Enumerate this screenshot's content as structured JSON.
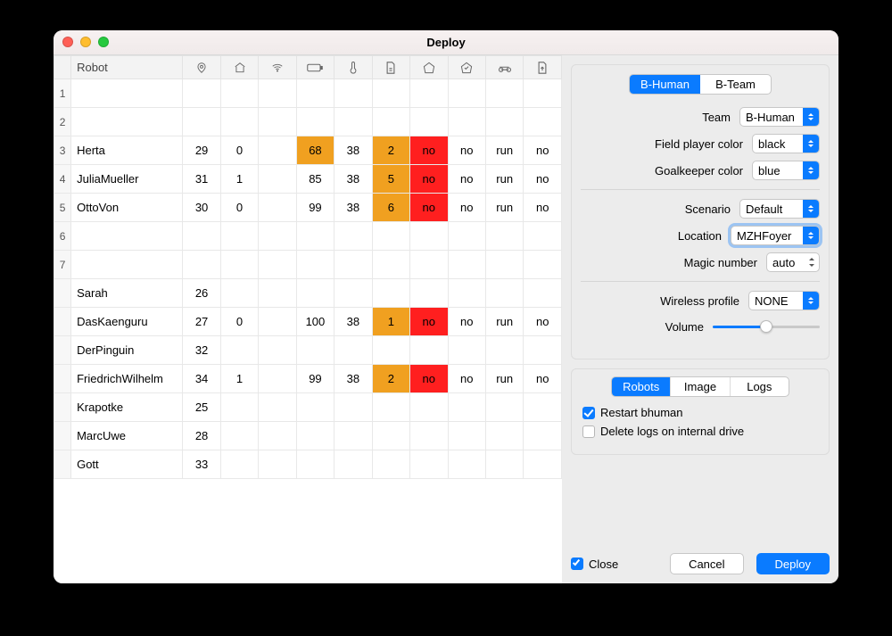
{
  "window": {
    "title": "Deploy"
  },
  "table": {
    "header": {
      "robot": "Robot"
    },
    "rows": [
      {
        "num": "1"
      },
      {
        "num": "2"
      },
      {
        "num": "3",
        "name": "Herta",
        "c1": "29",
        "c2": "0",
        "c4": "68",
        "c4c": "orange",
        "c5": "38",
        "c6": "2",
        "c6c": "orange",
        "c7": "no",
        "c7c": "red",
        "c8": "no",
        "c9": "run",
        "c10": "no"
      },
      {
        "num": "4",
        "name": "JuliaMueller",
        "c1": "31",
        "c2": "1",
        "c4": "85",
        "c5": "38",
        "c6": "5",
        "c6c": "orange",
        "c7": "no",
        "c7c": "red",
        "c8": "no",
        "c9": "run",
        "c10": "no"
      },
      {
        "num": "5",
        "name": "OttoVon",
        "c1": "30",
        "c2": "0",
        "c4": "99",
        "c5": "38",
        "c6": "6",
        "c6c": "orange",
        "c7": "no",
        "c7c": "red",
        "c8": "no",
        "c9": "run",
        "c10": "no"
      },
      {
        "num": "6"
      },
      {
        "num": "7"
      },
      {
        "name": "Sarah",
        "c1": "26"
      },
      {
        "name": "DasKaenguru",
        "c1": "27",
        "c2": "0",
        "c4": "100",
        "c5": "38",
        "c6": "1",
        "c6c": "orange",
        "c7": "no",
        "c7c": "red",
        "c8": "no",
        "c9": "run",
        "c10": "no"
      },
      {
        "name": "DerPinguin",
        "c1": "32"
      },
      {
        "name": "FriedrichWilhelm",
        "c1": "34",
        "c2": "1",
        "c4": "99",
        "c5": "38",
        "c6": "2",
        "c6c": "orange",
        "c7": "no",
        "c7c": "red",
        "c8": "no",
        "c9": "run",
        "c10": "no"
      },
      {
        "name": "Krapotke",
        "c1": "25"
      },
      {
        "name": "MarcUwe",
        "c1": "28"
      },
      {
        "name": "Gott",
        "c1": "33"
      }
    ]
  },
  "side": {
    "tabs": {
      "a": "B-Human",
      "b": "B-Team"
    },
    "team": {
      "label": "Team",
      "value": "B-Human"
    },
    "field_color": {
      "label": "Field player color",
      "value": "black"
    },
    "goalkeeper_color": {
      "label": "Goalkeeper color",
      "value": "blue"
    },
    "scenario": {
      "label": "Scenario",
      "value": "Default"
    },
    "location": {
      "label": "Location",
      "value": "MZHFoyer"
    },
    "magic": {
      "label": "Magic number",
      "value": "auto"
    },
    "wireless": {
      "label": "Wireless profile",
      "value": "NONE"
    },
    "volume": {
      "label": "Volume",
      "pct": 50
    },
    "tabs2": {
      "a": "Robots",
      "b": "Image",
      "c": "Logs"
    },
    "restart": {
      "label": "Restart bhuman",
      "checked": true
    },
    "deletelogs": {
      "label": "Delete logs on internal drive",
      "checked": false
    }
  },
  "footer": {
    "close": "Close",
    "cancel": "Cancel",
    "deploy": "Deploy"
  }
}
